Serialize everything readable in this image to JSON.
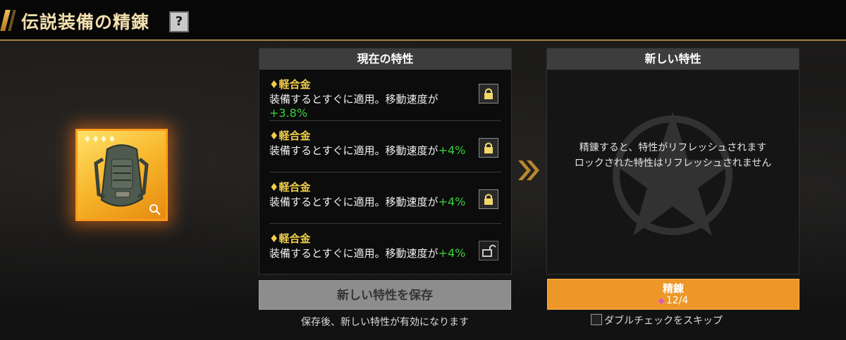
{
  "header": {
    "title": "伝説装備の精錬",
    "help_icon": "?"
  },
  "item": {
    "name_icon": "backpack",
    "stars": "♦♦♦♦",
    "rarity_color": "#ff9a1a"
  },
  "current_panel": {
    "title": "現在の特性",
    "attributes": [
      {
        "name": "♦軽合金",
        "desc": "装備するとすぐに適用。移動速度が",
        "value": "+3.8%",
        "locked": true
      },
      {
        "name": "♦軽合金",
        "desc": "装備するとすぐに適用。移動速度が",
        "value": "+4%",
        "locked": true
      },
      {
        "name": "♦軽合金",
        "desc": "装備するとすぐに適用。移動速度が",
        "value": "+4%",
        "locked": true
      },
      {
        "name": "♦軽合金",
        "desc": "装備するとすぐに適用。移動速度が",
        "value": "+4%",
        "locked": false
      }
    ]
  },
  "new_panel": {
    "title": "新しい特性",
    "message_line1": "精錬すると、特性がリフレッシュされます",
    "message_line2": "ロックされた特性はリフレッシュされません"
  },
  "save_button": {
    "label": "新しい特性を保存",
    "note": "保存後、新しい特性が有効になります"
  },
  "refine_button": {
    "label": "精錬",
    "cost": "12/4",
    "cost_icon": "gem-icon"
  },
  "skip_check": {
    "label": "ダブルチェックをスキップ",
    "checked": false
  },
  "colors": {
    "accent": "#ec9728",
    "value_green": "#39d13a",
    "attr_name": "#f1cf4a",
    "title": "#f3dfae"
  }
}
